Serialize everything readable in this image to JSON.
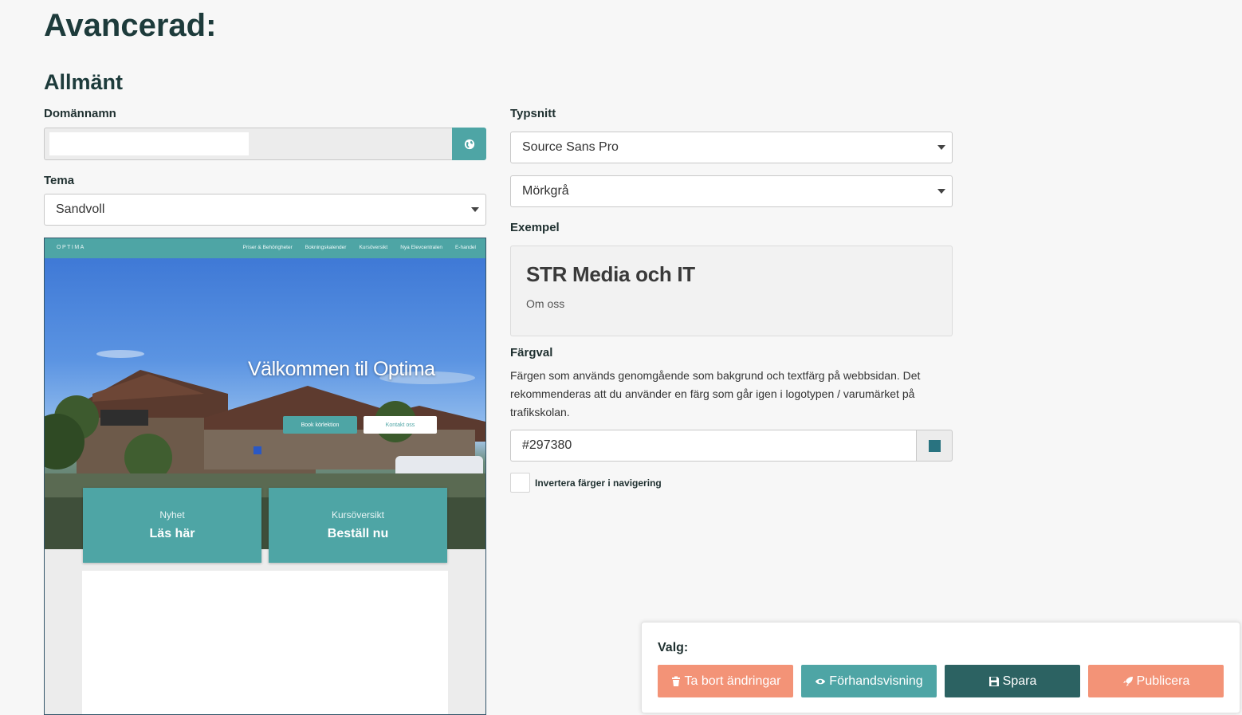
{
  "page": {
    "title": "Avancerad:",
    "section_title": "Allmänt"
  },
  "domain": {
    "label": "Domännamn",
    "value": "",
    "button_icon": "globe-icon"
  },
  "theme": {
    "label": "Tema",
    "selected": "Sandvoll"
  },
  "preview": {
    "logo": "OPTIMA",
    "nav_links": [
      "Priser & Behörigheter",
      "Bokningskalender",
      "Kursöversikt",
      "Nya Elevcentralen",
      "E-handel"
    ],
    "hero_title": "Välkommen til Optima",
    "primary_button": "Book körlektion",
    "secondary_button": "Kontakt oss",
    "cards": [
      {
        "small": "Nyhet",
        "big": "Läs här"
      },
      {
        "small": "Kursöversikt",
        "big": "Beställ nu"
      }
    ]
  },
  "font": {
    "label": "Typsnitt",
    "family_selected": "Source Sans Pro",
    "color_selected": "Mörkgrå"
  },
  "example": {
    "label": "Exempel",
    "title": "STR Media och IT",
    "subtitle": "Om oss"
  },
  "color": {
    "label": "Färgval",
    "description": "Färgen som används genomgående som bakgrund och textfärg på webbsidan. Det rekommenderas att du använder en färg som går igen i logotypen / varumärket på trafikskolan.",
    "value": "#297380",
    "swatch": "#297380"
  },
  "invert": {
    "label": "Invertera färger i navigering",
    "checked": false
  },
  "actions": {
    "title": "Valg:",
    "delete_label": "Ta bort ändringar",
    "preview_label": "Förhandsvisning",
    "save_label": "Spara",
    "publish_label": "Publicera"
  },
  "colors": {
    "accent": "#4ea5a5",
    "dark": "#2c6262",
    "warm": "#f39377",
    "heading": "#1d3b3b"
  }
}
